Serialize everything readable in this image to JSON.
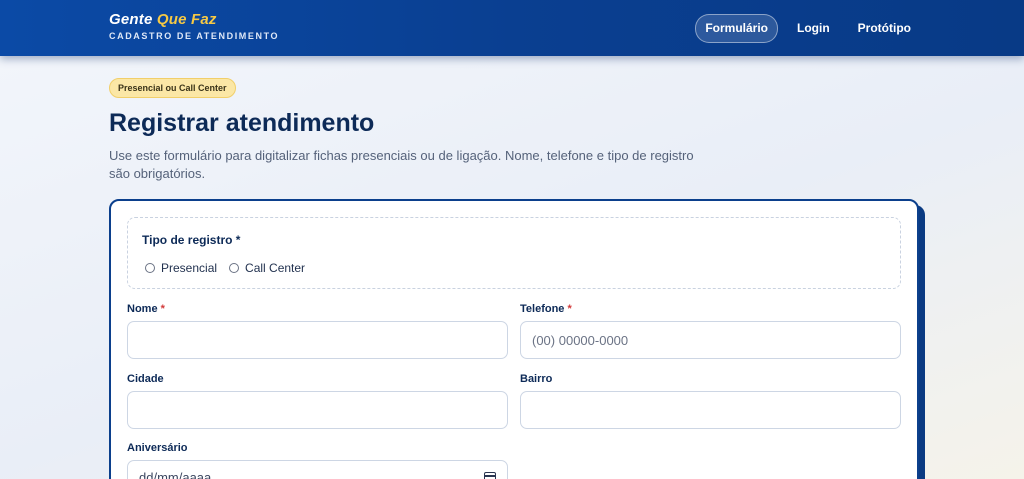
{
  "header": {
    "brand_main": "Gente",
    "brand_accent": "Que Faz",
    "brand_subtitle": "CADASTRO DE ATENDIMENTO",
    "nav": [
      {
        "label": "Formulário",
        "active": true
      },
      {
        "label": "Login",
        "active": false
      },
      {
        "label": "Protótipo",
        "active": false
      }
    ]
  },
  "intro": {
    "badge": "Presencial ou Call Center",
    "title": "Registrar atendimento",
    "description": "Use este formulário para digitalizar fichas presenciais ou de ligação. Nome, telefone e tipo de registro são obrigatórios."
  },
  "form": {
    "tipo_registro": {
      "label": "Tipo de registro *",
      "options": [
        "Presencial",
        "Call Center"
      ]
    },
    "nome": {
      "label": "Nome",
      "required_mark": "*",
      "value": "",
      "placeholder": ""
    },
    "telefone": {
      "label": "Telefone",
      "required_mark": "*",
      "value": "",
      "placeholder": "(00) 00000-0000"
    },
    "cidade": {
      "label": "Cidade",
      "value": "",
      "placeholder": ""
    },
    "bairro": {
      "label": "Bairro",
      "value": "",
      "placeholder": ""
    },
    "aniversario": {
      "label": "Aniversário",
      "placeholder": "dd/mm/aaaa"
    }
  },
  "icons": {
    "date_picker": "calendar-icon",
    "radio": "radio-circle-icon"
  },
  "colors": {
    "header_bg": "#0b4aa6",
    "brand_accent": "#f6c945",
    "title": "#0d2a57",
    "card_border": "#0b3f8c",
    "badge_bg": "#fbe7a6",
    "required": "#d23a3a"
  }
}
